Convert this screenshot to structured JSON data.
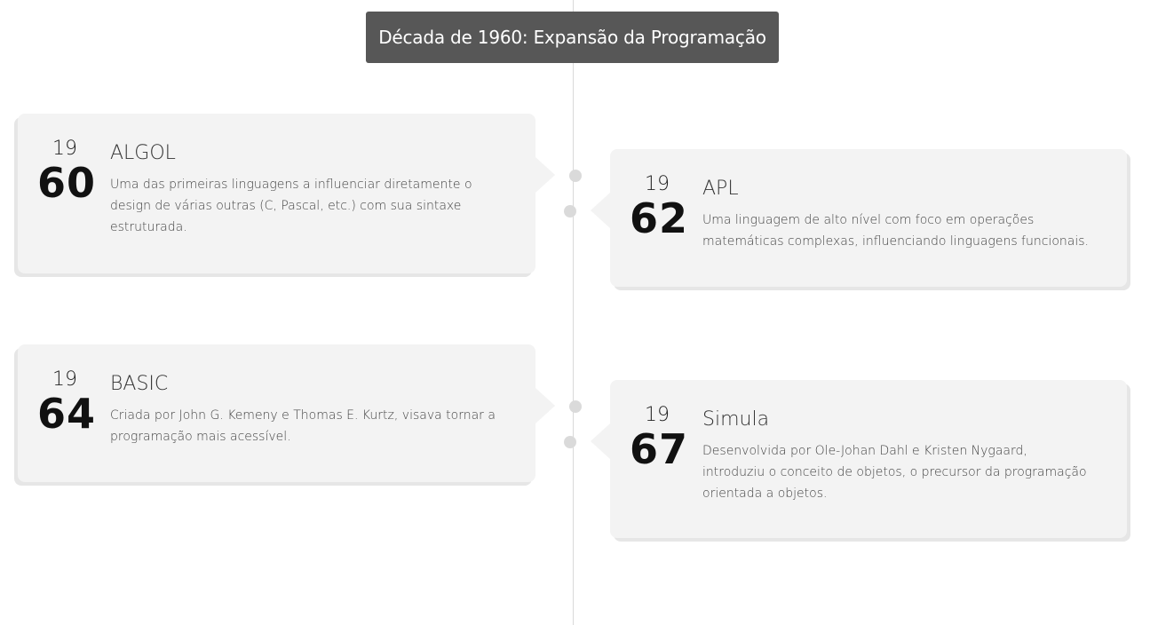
{
  "header": {
    "title": "Década de 1960: Expansão da Programação"
  },
  "events": [
    {
      "century": "19",
      "digits": "60",
      "title": "ALGOL",
      "description": "Uma das primeiras linguagens a influenciar diretamente o design de várias outras (C, Pascal, etc.) com sua sintaxe estruturada."
    },
    {
      "century": "19",
      "digits": "62",
      "title": "APL",
      "description": "Uma linguagem de alto nível com foco em operações matemáticas complexas, influenciando linguagens funcionais."
    },
    {
      "century": "19",
      "digits": "64",
      "title": "BASIC",
      "description": "Criada por John G. Kemeny e Thomas E. Kurtz, visava tornar a programação mais acessível."
    },
    {
      "century": "19",
      "digits": "67",
      "title": "Simula",
      "description": "Desenvolvida por Ole-Johan Dahl e Kristen Nygaard, introduziu o conceito de objetos, o precursor da programação orientada a objetos."
    }
  ],
  "colors": {
    "header_bg": "#575757",
    "card_bg": "#f3f3f3",
    "line": "#d9d9d9",
    "dot": "#dadada"
  }
}
